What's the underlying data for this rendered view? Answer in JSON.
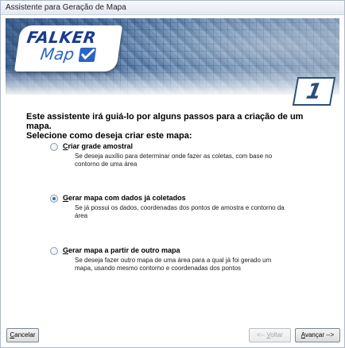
{
  "window": {
    "title": "Assistente para Geração de Mapa"
  },
  "banner": {
    "logo_name": "FALKER",
    "logo_sub": "Map",
    "step_number": "1"
  },
  "intro": {
    "line1": "Este assistente irá guiá-lo por alguns passos para a criação de um mapa.",
    "line2": "Selecione como deseja criar este mapa:"
  },
  "options": [
    {
      "accel": "C",
      "label_rest": "riar grade amostral",
      "description": "Se deseja auxílio para determinar onde fazer as coletas, com base no contorno de uma área",
      "checked": false
    },
    {
      "accel": "G",
      "label_rest": "erar mapa com dados já coletados",
      "description": "Se já possui os dados, coordenadas dos pontos de amostra e contorno da área",
      "checked": true
    },
    {
      "accel": "G",
      "label_rest": "erar mapa a partir de outro mapa",
      "description": "Se deseja fazer outro mapa de uma área para a qual já foi gerado um mapa, usando mesmo contorno e coordenadas dos pontos",
      "checked": false
    }
  ],
  "buttons": {
    "cancel_accel": "C",
    "cancel_rest": "ancelar",
    "back_prefix": "<-- ",
    "back_accel": "V",
    "back_rest": "oltar",
    "next_accel": "A",
    "next_rest": "vançar -->"
  },
  "colors": {
    "accent": "#2a6fc2",
    "logo_blue": "#1a3a8c",
    "step_border": "#2a4f7a"
  }
}
